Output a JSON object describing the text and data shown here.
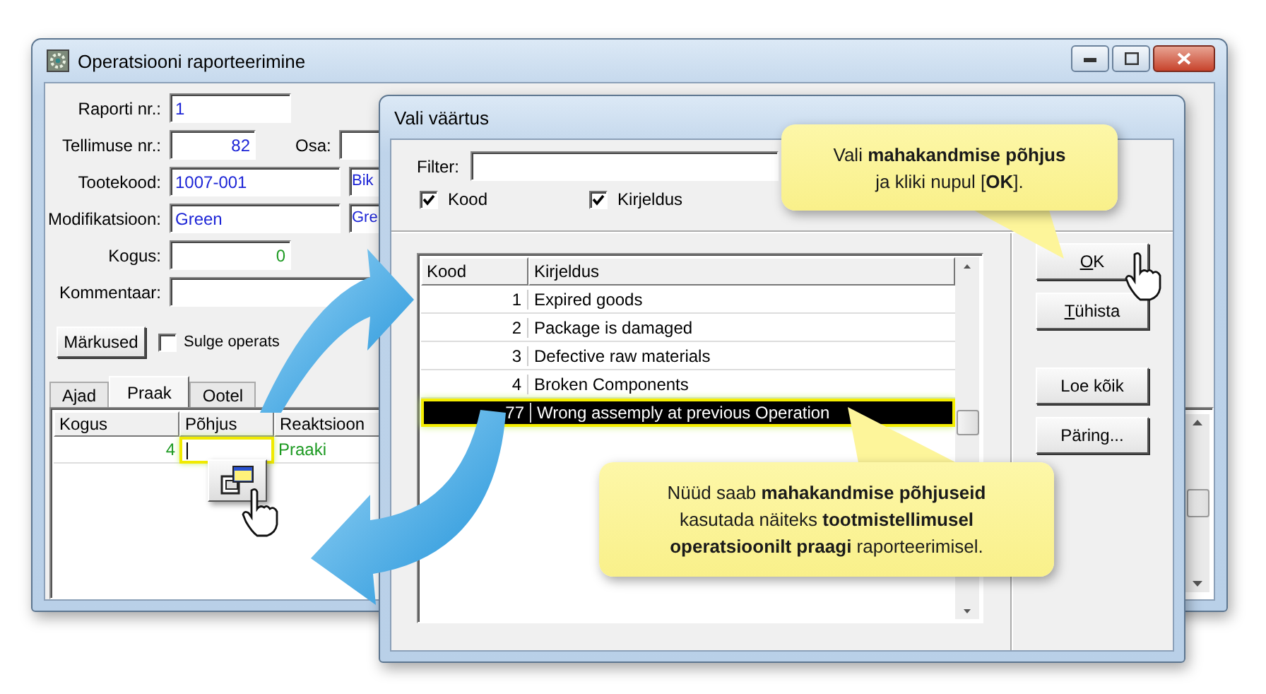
{
  "main_window": {
    "title": "Operatsiooni raporteerimine",
    "fields": [
      {
        "label": "Raporti nr.:",
        "value": "1",
        "kind": "text"
      },
      {
        "label": "Tellimuse nr.:",
        "value": "82",
        "kind": "number",
        "extra_label": "Osa:"
      },
      {
        "label": "Tootekood:",
        "value": "1007-001",
        "kind": "text",
        "extra_value": "Bik"
      },
      {
        "label": "Modifikatsioon:",
        "value": "Green",
        "kind": "text",
        "extra_value": "Gre"
      },
      {
        "label": "Kogus:",
        "value": "0",
        "kind": "quantity"
      },
      {
        "label": "Kommentaar:",
        "kind": "text"
      }
    ],
    "notes_button": "Märkused",
    "close_checkbox": {
      "label": "Sulge operats",
      "checked": false
    },
    "tabs": [
      {
        "label": "Ajad",
        "selected": false
      },
      {
        "label": "Praak",
        "selected": true
      },
      {
        "label": "Ootel",
        "selected": false
      }
    ],
    "grid": {
      "columns": [
        "Kogus",
        "Põhjus",
        "Reaktsioon"
      ],
      "rows": [
        {
          "quantity": "4",
          "reason_focused": true,
          "reaction": "Praaki"
        }
      ]
    }
  },
  "dialog": {
    "title": "Vali väärtus",
    "filter_label": "Filter:",
    "checkboxes": [
      {
        "label": "Kood",
        "checked": true
      },
      {
        "label": "Kirjeldus",
        "checked": true
      }
    ],
    "columns": [
      "Kood",
      "Kirjeldus"
    ],
    "rows": [
      {
        "code": "1",
        "description": "Expired goods",
        "selected": false
      },
      {
        "code": "2",
        "description": "Package is damaged",
        "selected": false
      },
      {
        "code": "3",
        "description": "Defective raw materials",
        "selected": false
      },
      {
        "code": "4",
        "description": "Broken Components",
        "selected": false
      },
      {
        "code": "77",
        "description": "Wrong assemply at previous Operation",
        "selected": true
      }
    ],
    "buttons": [
      {
        "label": "OK",
        "mnemonic": true
      },
      {
        "label": "Tühista",
        "mnemonic": true
      },
      {
        "label": "Loe kõik",
        "mnemonic": false
      },
      {
        "label": "Päring...",
        "mnemonic": false
      }
    ]
  },
  "callouts": [
    "Vali **mahakandmise põhjus** ja kliki nupul [**OK**].",
    "Nüüd saab **mahakandmise põhjuseid** kasutada näiteks **tootmistellimusel operatsioonilt praagi** raporteerimisel."
  ]
}
